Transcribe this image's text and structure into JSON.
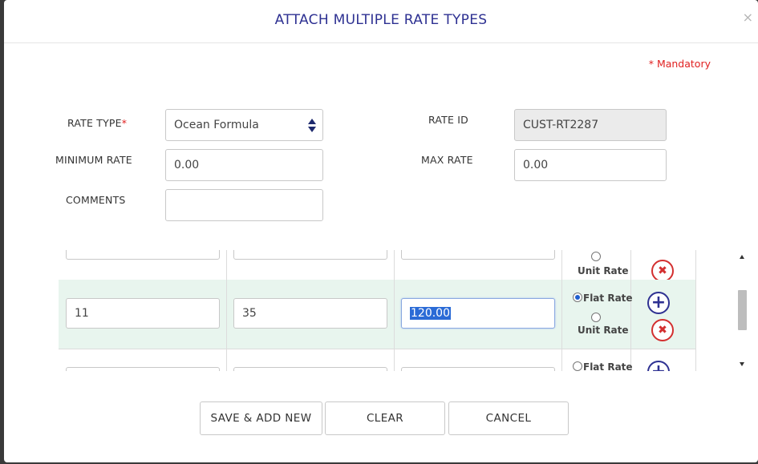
{
  "modal": {
    "title": "ATTACH MULTIPLE RATE TYPES",
    "close_glyph": "×",
    "mandatory_note": "* Mandatory"
  },
  "form": {
    "rate_type_label": "RATE TYPE",
    "required_mark": "*",
    "rate_type_value": "Ocean Formula",
    "rate_id_label": "RATE ID",
    "rate_id_value": "CUST-RT2287",
    "minimum_rate_label": "MINIMUM RATE",
    "minimum_rate_value": "0.00",
    "max_rate_label": "MAX RATE",
    "max_rate_value": "0.00",
    "comments_label": "COMMENTS",
    "comments_value": ""
  },
  "rows": {
    "top_partial": {
      "unit_rate_label": "Unit Rate"
    },
    "active": {
      "col1": "11",
      "col2": "35",
      "col3": "120.00",
      "flat_rate_label": "Flat Rate",
      "unit_rate_label": "Unit Rate",
      "selected_option": "Flat Rate"
    },
    "bottom_partial": {
      "flat_rate_label": "Flat Rate"
    }
  },
  "icons": {
    "add": "plus-circle-icon",
    "delete": "x-circle-icon",
    "plus_glyph": "+",
    "x_glyph": "✖"
  },
  "buttons": {
    "save_add_new": "SAVE & ADD NEW",
    "clear": "CLEAR",
    "cancel": "CANCEL"
  },
  "colors": {
    "title": "#2e3192",
    "required": "#e02020",
    "active_row_bg": "#e8f5ee",
    "add_icon": "#2e3192",
    "delete_icon": "#d32f2f"
  }
}
